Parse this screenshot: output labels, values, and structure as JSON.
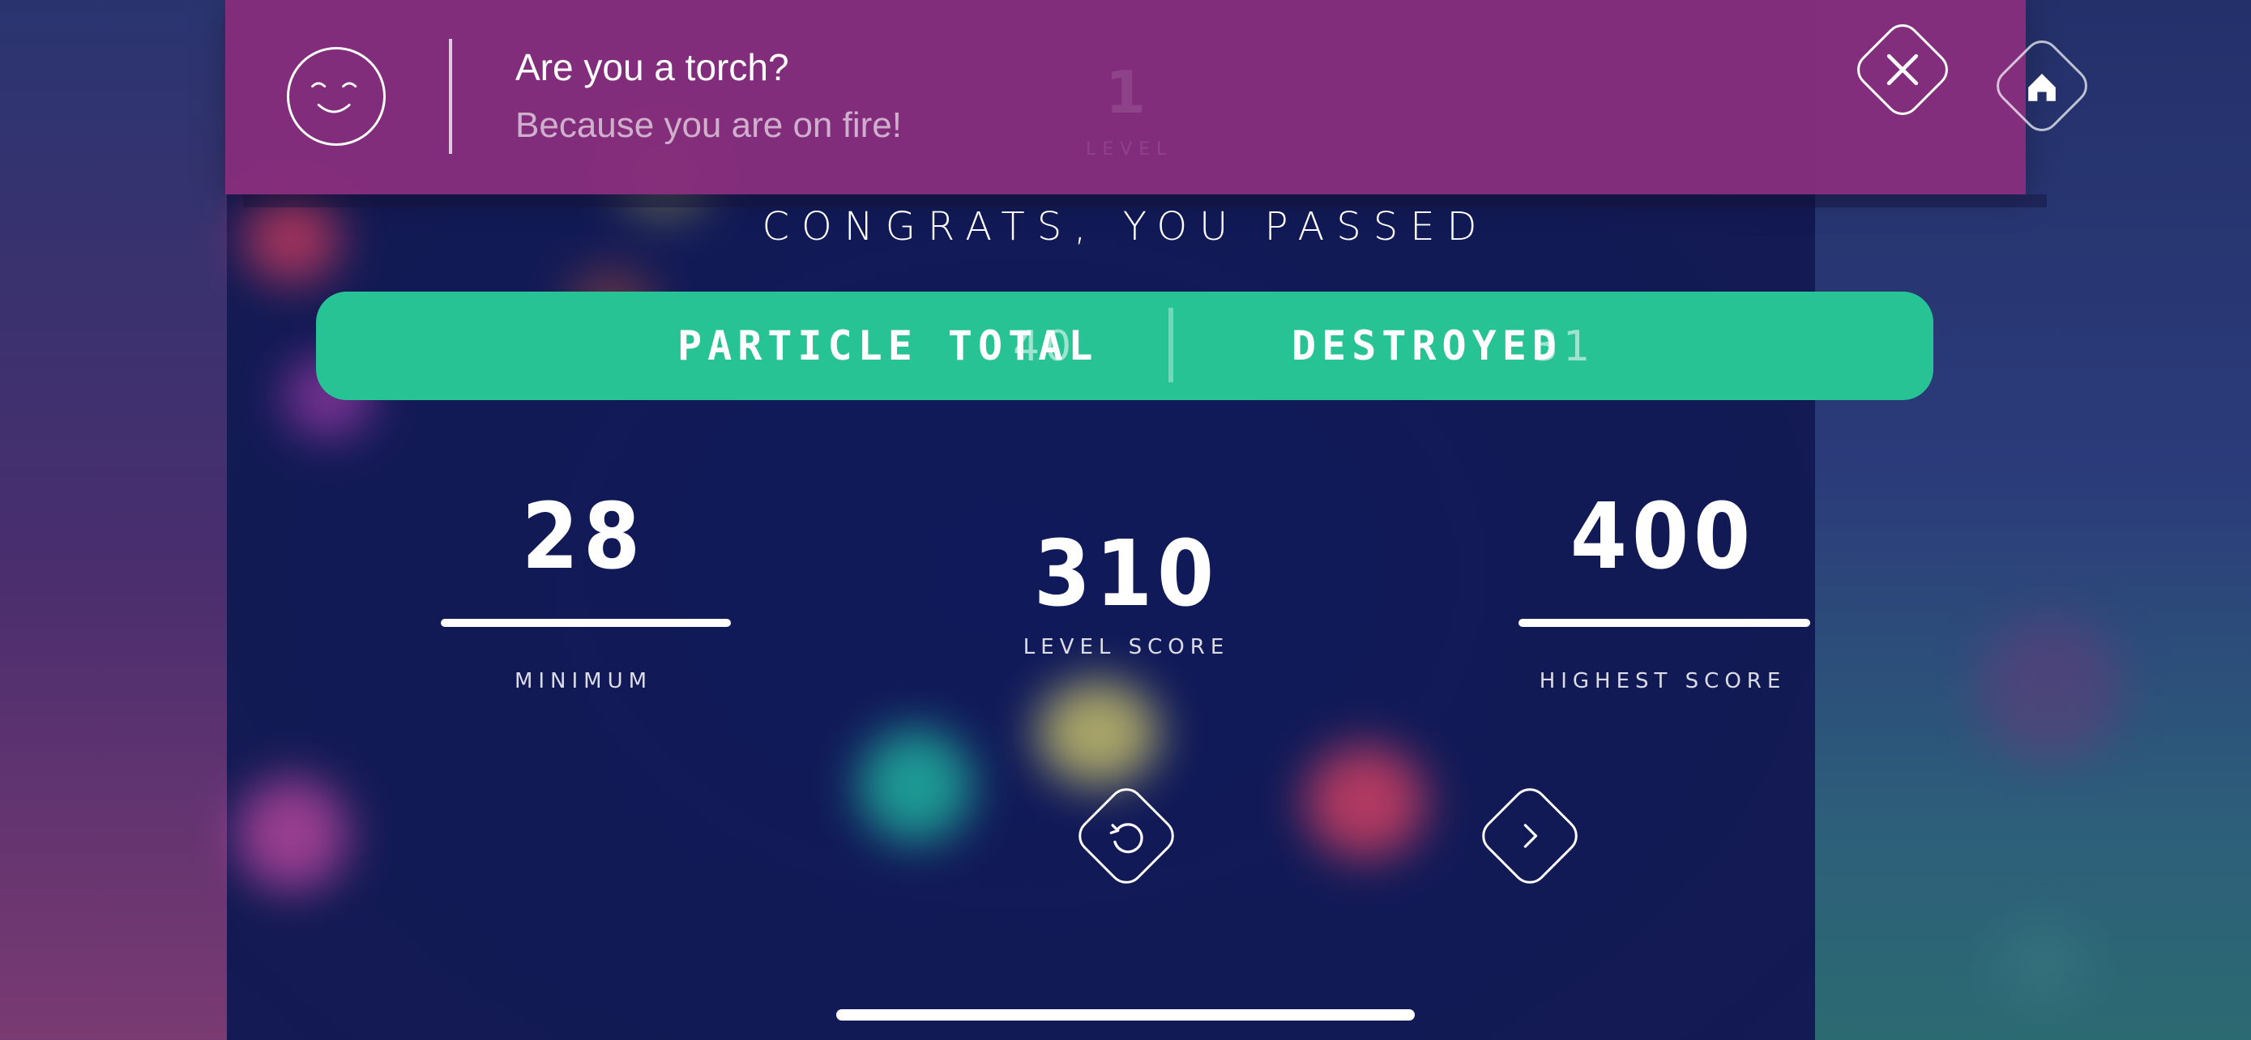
{
  "notification": {
    "title": "Are you a torch?",
    "message": "Because you are on fire!",
    "icon": "smiley-icon",
    "background_color": "#872e7d"
  },
  "background_level": {
    "number": "1",
    "label": "LEVEL"
  },
  "result": {
    "heading": "CONGRATS, YOU PASSED"
  },
  "stats": {
    "particle_total_label": "PARTICLE TOTAL",
    "particle_total_value": "40",
    "destroyed_label": "DESTROYED",
    "destroyed_value": "31",
    "bar_color": "#27c394"
  },
  "scores": {
    "minimum_value": "28",
    "minimum_label": "MINIMUM",
    "level_score_value": "310",
    "level_score_label": "LEVEL SCORE",
    "highest_value": "400",
    "highest_label": "HIGHEST SCORE"
  },
  "buttons": {
    "close_icon": "close-icon",
    "home_icon": "home-icon",
    "retry_icon": "retry-icon",
    "next_icon": "chevron-right-icon"
  }
}
